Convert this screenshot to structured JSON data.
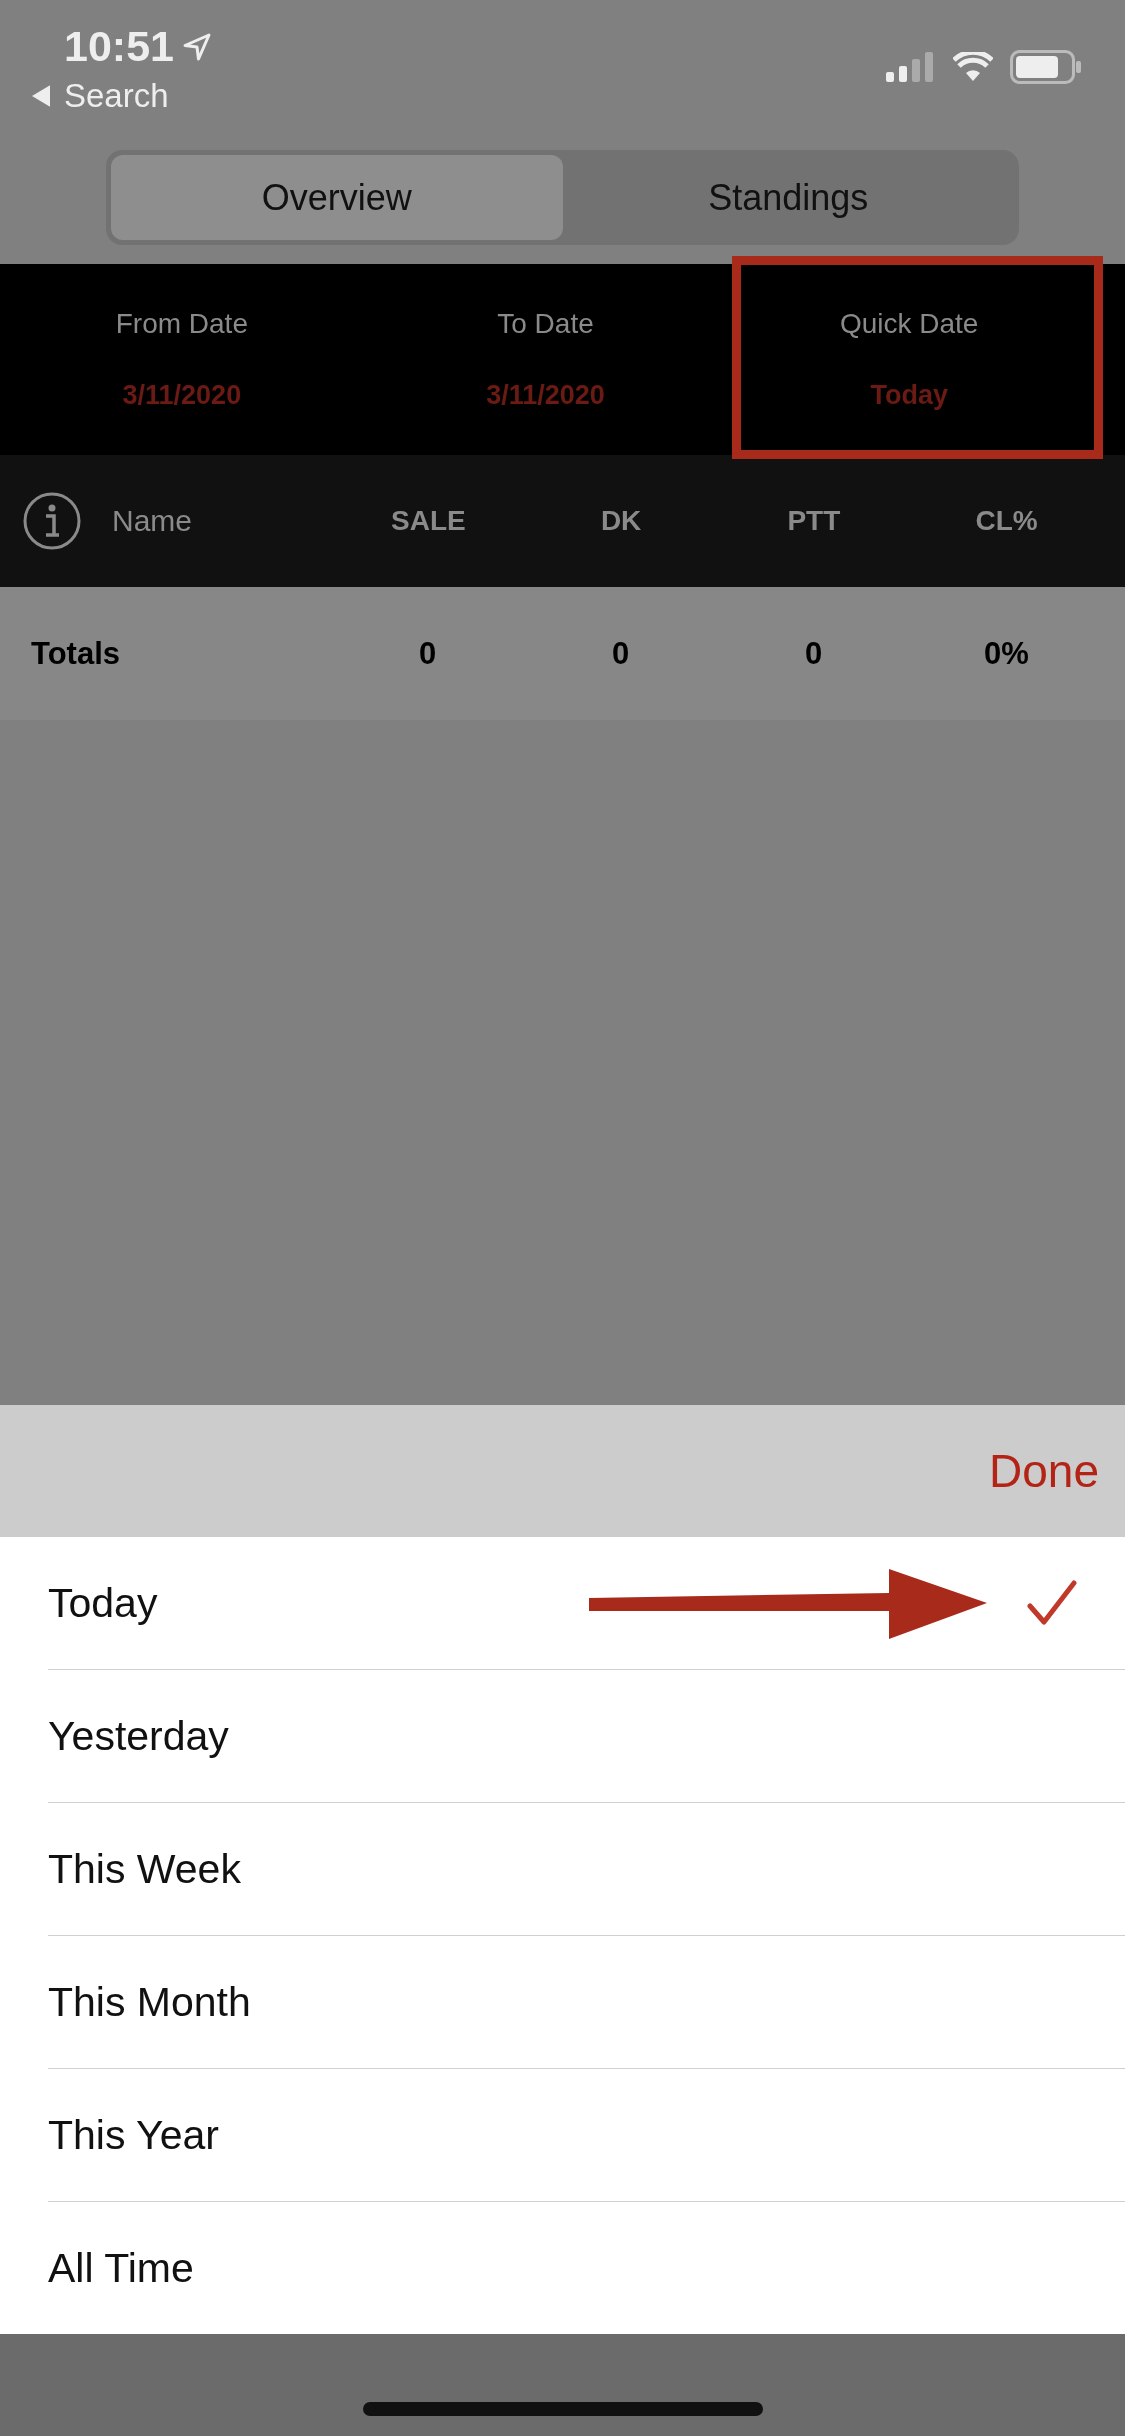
{
  "status_bar": {
    "time": "10:51",
    "back_label": "Search"
  },
  "segments": [
    {
      "label": "Overview",
      "selected": true
    },
    {
      "label": "Standings",
      "selected": false
    }
  ],
  "date_filters": [
    {
      "label": "From Date",
      "value": "3/11/2020",
      "highlighted": false
    },
    {
      "label": "To Date",
      "value": "3/11/2020",
      "highlighted": false
    },
    {
      "label": "Quick Date",
      "value": "Today",
      "highlighted": true
    }
  ],
  "columns": [
    "Name",
    "SALE",
    "DK",
    "PTT",
    "CL%"
  ],
  "totals": {
    "label": "Totals",
    "values": [
      "0",
      "0",
      "0",
      "0%"
    ]
  },
  "picker": {
    "done": "Done",
    "options": [
      {
        "label": "Today",
        "selected": true,
        "pointed": true
      },
      {
        "label": "Yesterday",
        "selected": false,
        "pointed": false
      },
      {
        "label": "This Week",
        "selected": false,
        "pointed": false
      },
      {
        "label": "This Month",
        "selected": false,
        "pointed": false
      },
      {
        "label": "This Year",
        "selected": false,
        "pointed": false
      },
      {
        "label": "All Time",
        "selected": false,
        "pointed": false
      }
    ]
  }
}
